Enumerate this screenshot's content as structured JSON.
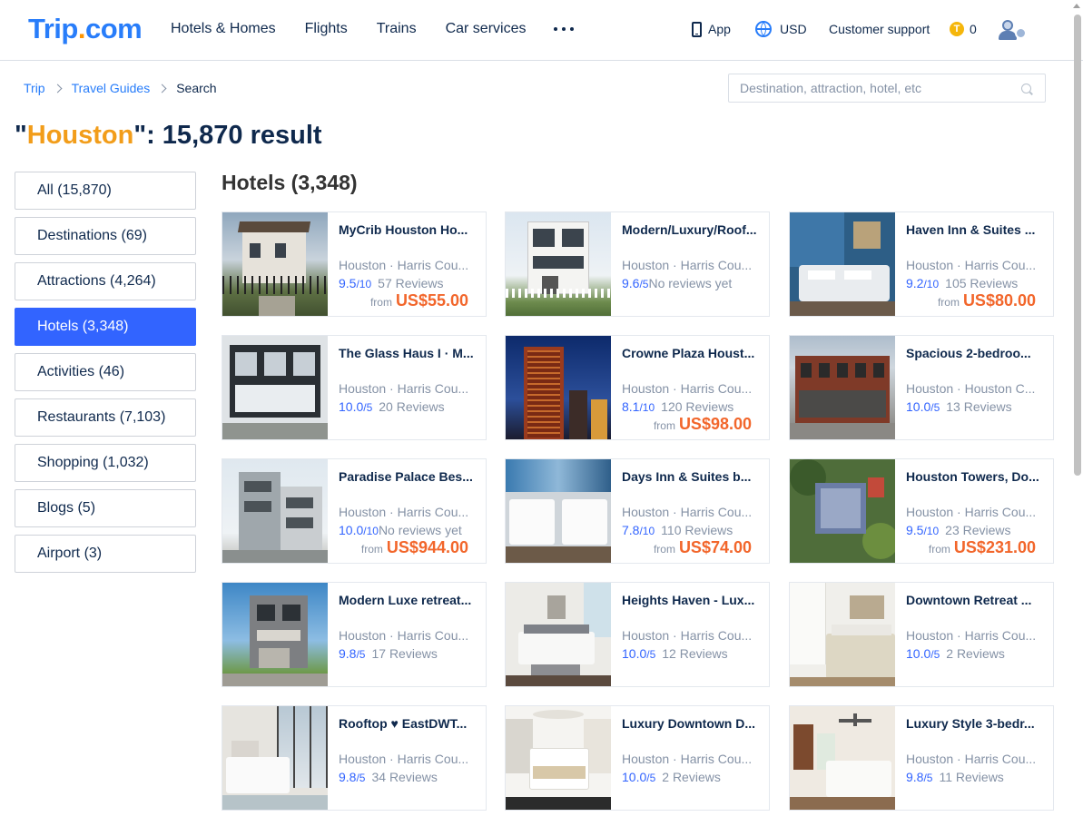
{
  "header": {
    "logo_main": "Trip",
    "logo_dot": ".",
    "logo_tail": "com",
    "nav": [
      "Hotels & Homes",
      "Flights",
      "Trains",
      "Car services"
    ],
    "app_label": "App",
    "currency_label": "USD",
    "support_label": "Customer support",
    "coins": "0"
  },
  "breadcrumb": {
    "items": [
      "Trip",
      "Travel Guides"
    ],
    "current": "Search"
  },
  "search": {
    "placeholder": "Destination, attraction, hotel, etc"
  },
  "title": {
    "open_quote": "\"",
    "keyword": "Houston",
    "rest": "\": 15,870 result"
  },
  "sidebar": {
    "categories": [
      {
        "label": "All (15,870)",
        "active": false
      },
      {
        "label": "Destinations (69)",
        "active": false
      },
      {
        "label": "Attractions (4,264)",
        "active": false
      },
      {
        "label": "Hotels (3,348)",
        "active": true
      },
      {
        "label": "Activities (46)",
        "active": false
      },
      {
        "label": "Restaurants (7,103)",
        "active": false
      },
      {
        "label": "Shopping (1,032)",
        "active": false
      },
      {
        "label": "Blogs (5)",
        "active": false
      },
      {
        "label": "Airport (3)",
        "active": false
      }
    ]
  },
  "section_title": "Hotels (3,348)",
  "hotels": [
    {
      "name": "MyCrib Houston Ho...",
      "location": "Houston · Harris Cou...",
      "score": "9.5",
      "scale": "/10",
      "reviews": "57 Reviews",
      "price_from": "from",
      "price": "US$55.00",
      "thumb": "thumb-house-exterior"
    },
    {
      "name": "Modern/Luxury/Roof...",
      "location": "Houston · Harris Cou...",
      "score": "9.6",
      "scale": "/5",
      "reviews": "No reviews yet",
      "price_from": "",
      "price": "",
      "thumb": "thumb-white-townhouse"
    },
    {
      "name": "Haven Inn & Suites ...",
      "location": "Houston · Harris Cou...",
      "score": "9.2",
      "scale": "/10",
      "reviews": "105 Reviews",
      "price_from": "from",
      "price": "US$80.00",
      "thumb": "thumb-hotel-room-blue"
    },
    {
      "name": "The Glass Haus I · M...",
      "location": "Houston · Harris Cou...",
      "score": "10.0",
      "scale": "/5",
      "reviews": "20 Reviews",
      "price_from": "",
      "price": "",
      "thumb": "thumb-glass-house"
    },
    {
      "name": "Crowne Plaza Houst...",
      "location": "Houston · Harris Cou...",
      "score": "8.1",
      "scale": "/10",
      "reviews": "120 Reviews",
      "price_from": "from",
      "price": "US$98.00",
      "thumb": "thumb-tower-night"
    },
    {
      "name": "Spacious 2-bedroo...",
      "location": "Houston · Houston C...",
      "score": "10.0",
      "scale": "/5",
      "reviews": "13 Reviews",
      "price_from": "",
      "price": "",
      "thumb": "thumb-brick-building"
    },
    {
      "name": "Paradise Palace Bes...",
      "location": "Houston · Harris Cou...",
      "score": "10.0",
      "scale": "/10",
      "reviews": "No reviews yet",
      "price_from": "from",
      "price": "US$944.00",
      "thumb": "thumb-grey-townhouses"
    },
    {
      "name": "Days Inn & Suites b...",
      "location": "Houston · Harris Cou...",
      "score": "7.8",
      "scale": "/10",
      "reviews": "110 Reviews",
      "price_from": "from",
      "price": "US$74.00",
      "thumb": "thumb-hotel-room-beds"
    },
    {
      "name": "Houston Towers, Do...",
      "location": "Houston · Harris Cou...",
      "score": "9.5",
      "scale": "/10",
      "reviews": "23 Reviews",
      "price_from": "from",
      "price": "US$231.00",
      "thumb": "thumb-aerial-mansion"
    },
    {
      "name": "Modern Luxe retreat...",
      "location": "Houston · Harris Cou...",
      "score": "9.8",
      "scale": "/5",
      "reviews": "17 Reviews",
      "price_from": "",
      "price": "",
      "thumb": "thumb-modern-house"
    },
    {
      "name": "Heights Haven - Lux...",
      "location": "Houston · Harris Cou...",
      "score": "10.0",
      "scale": "/5",
      "reviews": "12 Reviews",
      "price_from": "",
      "price": "",
      "thumb": "thumb-bedroom-grey"
    },
    {
      "name": "Downtown Retreat ...",
      "location": "Houston · Harris Cou...",
      "score": "10.0",
      "scale": "/5",
      "reviews": "2 Reviews",
      "price_from": "",
      "price": "",
      "thumb": "thumb-bedroom-white"
    },
    {
      "name": "Rooftop ♥ EastDWT...",
      "location": "Houston · Harris Cou...",
      "score": "9.8",
      "scale": "/5",
      "reviews": "34 Reviews",
      "price_from": "",
      "price": "",
      "thumb": "thumb-bedroom-window"
    },
    {
      "name": "Luxury Downtown D...",
      "location": "Houston · Harris Cou...",
      "score": "10.0",
      "scale": "/5",
      "reviews": "2 Reviews",
      "price_from": "",
      "price": "",
      "thumb": "thumb-bedroom-bright"
    },
    {
      "name": "Luxury Style 3-bedr...",
      "location": "Houston · Harris Cou...",
      "score": "9.8",
      "scale": "/5",
      "reviews": "11 Reviews",
      "price_from": "",
      "price": "",
      "thumb": "thumb-bedroom-fan"
    }
  ],
  "colors": {
    "brand_blue": "#287dfa",
    "active_blue": "#3264ff",
    "keyword_orange": "#f29d1a",
    "price_orange": "#f2662b",
    "text_dark": "#0f294d",
    "text_muted": "#8592a6"
  }
}
